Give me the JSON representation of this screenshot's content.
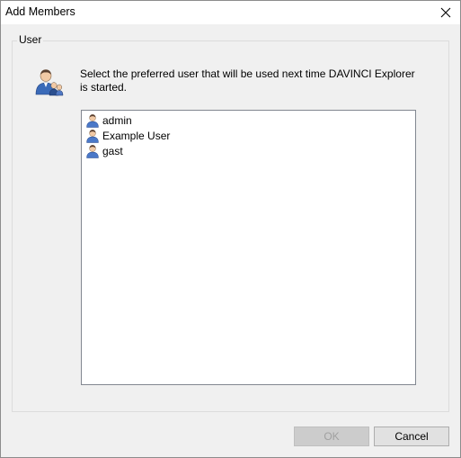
{
  "window": {
    "title": "Add Members",
    "close_icon": "close-icon"
  },
  "group": {
    "legend": "User",
    "icon": "users-icon",
    "instructions": "Select the preferred user that will be used next time DAVINCI Explorer is started."
  },
  "users": [
    {
      "name": "admin",
      "icon": "user-icon"
    },
    {
      "name": "Example User",
      "icon": "user-icon"
    },
    {
      "name": "gast",
      "icon": "user-icon"
    }
  ],
  "buttons": {
    "ok_label": "OK",
    "ok_enabled": false,
    "cancel_label": "Cancel"
  }
}
